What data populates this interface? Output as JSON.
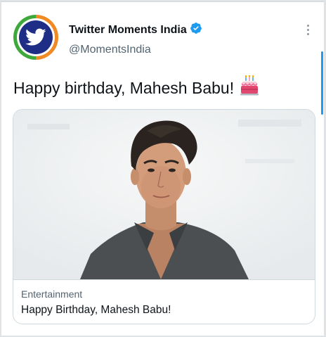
{
  "account": {
    "name": "Twitter Moments India",
    "handle": "@MomentsIndia",
    "verified": true,
    "avatar_icon": "twitter-bird-icon"
  },
  "tweet": {
    "text": "Happy birthday, Mahesh Babu!",
    "emoji_icon": "birthday-cake-icon"
  },
  "card": {
    "image_description": "portrait-photo",
    "category": "Entertainment",
    "title": "Happy Birthday, Mahesh Babu!"
  },
  "colors": {
    "verified_badge": "#1d9bf0",
    "avatar_ring_orange": "#f08a24",
    "avatar_ring_green": "#3fa83a",
    "avatar_core": "#1e2d86"
  }
}
